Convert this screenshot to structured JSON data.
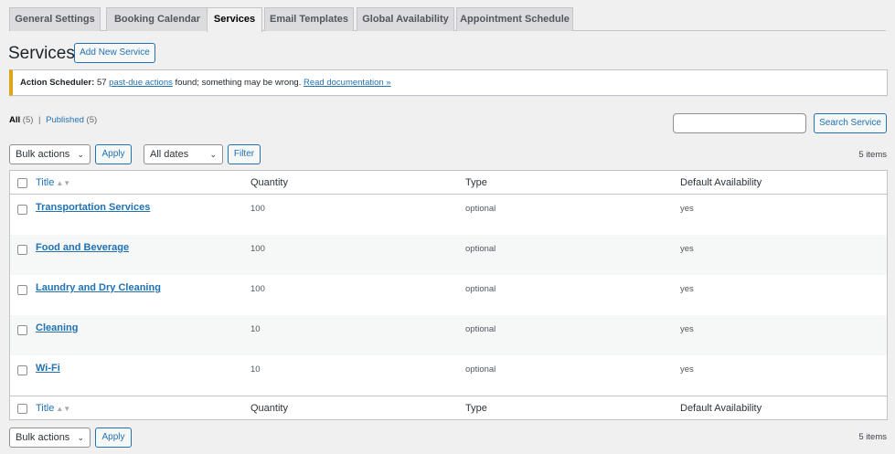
{
  "tabs": [
    {
      "label": "General Settings"
    },
    {
      "label": "Booking Calendar"
    },
    {
      "label": "Services"
    },
    {
      "label": "Email Templates"
    },
    {
      "label": "Global Availability"
    },
    {
      "label": "Appointment Schedule"
    }
  ],
  "page": {
    "title": "Services",
    "add_new": "Add New Service"
  },
  "notice": {
    "prefix": "Action Scheduler:",
    "count": "57",
    "link1": "past-due actions",
    "middle": "found; something may be wrong.",
    "link2": "Read documentation »"
  },
  "views": {
    "all": "All",
    "all_count": "(5)",
    "sep": "|",
    "published": "Published",
    "published_count": "(5)"
  },
  "search": {
    "button": "Search Service",
    "placeholder": ""
  },
  "toolbar_top": {
    "bulk": "Bulk actions",
    "apply": "Apply",
    "dates": "All dates",
    "filter": "Filter",
    "items": "5 items"
  },
  "toolbar_bottom": {
    "bulk": "Bulk actions",
    "apply": "Apply",
    "items": "5 items"
  },
  "columns": {
    "title": "Title",
    "quantity": "Quantity",
    "type": "Type",
    "availability": "Default Availability"
  },
  "rows": [
    {
      "title": "Transportation Services",
      "quantity": "100",
      "type": "optional",
      "availability": "yes"
    },
    {
      "title": "Food and Beverage",
      "quantity": "100",
      "type": "optional",
      "availability": "yes"
    },
    {
      "title": "Laundry and Dry Cleaning",
      "quantity": "100",
      "type": "optional",
      "availability": "yes"
    },
    {
      "title": "Cleaning",
      "quantity": "10",
      "type": "optional",
      "availability": "yes"
    },
    {
      "title": "Wi-Fi",
      "quantity": "10",
      "type": "optional",
      "availability": "yes"
    }
  ],
  "colors": {
    "accent": "#2271b1",
    "notice_border": "#dba617"
  }
}
